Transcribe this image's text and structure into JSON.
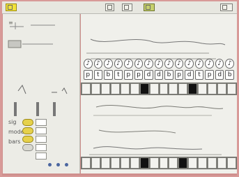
{
  "toolbar": {
    "items": [
      {
        "label": "☰",
        "state": "active",
        "name": "menu-button"
      },
      {
        "label": "◫",
        "state": "normal",
        "name": "window-button"
      },
      {
        "label": "▣",
        "state": "normal",
        "name": "page-button"
      },
      {
        "label": "■",
        "state": "green",
        "name": "highlight-button"
      },
      {
        "label": "◻",
        "state": "normal",
        "name": "panel-button"
      }
    ]
  },
  "sidebar": {
    "top_note": "≡",
    "labels": [
      "sig",
      "mode",
      "bars"
    ],
    "input_values": [
      "",
      "",
      "",
      "",
      ""
    ],
    "toggles": [
      true,
      true,
      true,
      false
    ],
    "dots": 3
  },
  "main": {
    "glyph_row_1": [
      "♪",
      "♪",
      "♪",
      "♪",
      "♪",
      "♪",
      "♪",
      "♪",
      "♪",
      "♪",
      "♪",
      "♪",
      "♪",
      "♪",
      "♪"
    ],
    "glyph_row_2": [
      "p",
      "t",
      "b",
      "t",
      "p",
      "p",
      "d",
      "d",
      "b",
      "p",
      "d",
      "t",
      "p",
      "d",
      "b"
    ],
    "cells_row_1": [
      "",
      "",
      "",
      "",
      "",
      "",
      "",
      "",
      "",
      "",
      "",
      "",
      "",
      "",
      "",
      ""
    ],
    "cells_row_2": [
      "",
      "",
      "",
      "",
      "",
      "",
      "",
      "",
      "",
      "",
      "",
      "",
      "",
      "",
      "",
      ""
    ],
    "dark_indexes_1": [
      6,
      11
    ],
    "dark_indexes_2": [
      6,
      10
    ],
    "markings_top": [
      "~",
      "~",
      "~",
      "~"
    ],
    "markings_bottom": [
      "~",
      "~",
      "~"
    ]
  },
  "accent": "#f1e33b",
  "selection": "#111111"
}
